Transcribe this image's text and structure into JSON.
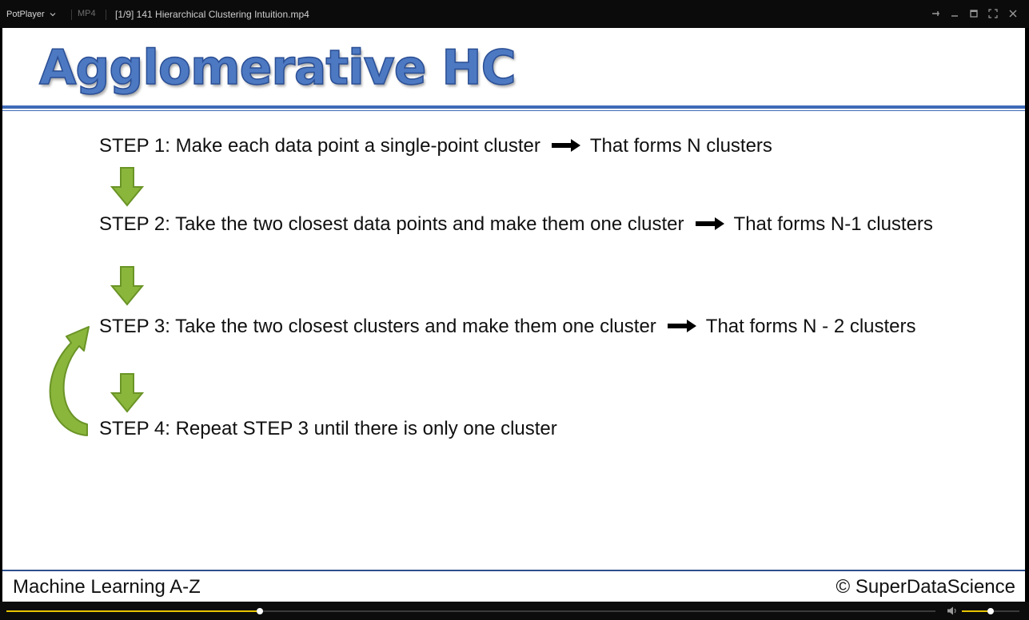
{
  "titlebar": {
    "app_name": "PotPlayer",
    "format_badge": "MP4",
    "file_title": "[1/9] 141 Hierarchical Clustering Intuition.mp4",
    "icons": [
      "chevron-down-icon",
      "pin-icon",
      "minimize-icon",
      "maximize-icon",
      "fullscreen-icon",
      "close-icon"
    ]
  },
  "slide": {
    "title": "Agglomerative HC",
    "steps": [
      {
        "label": "STEP 1",
        "text": ": Make each data point a single-point cluster",
        "result": "That forms N clusters"
      },
      {
        "label": "STEP 2",
        "text": ": Take the two closest data points and make them one cluster",
        "result": "That forms N-1 clusters"
      },
      {
        "label": "STEP 3",
        "text": ": Take the two closest clusters and make them one cluster",
        "result": "That forms N - 2 clusters"
      },
      {
        "label": "STEP 4",
        "text_pre": ": Repeat ",
        "ref": "STEP 3",
        "text_post": " until there is only one cluster"
      }
    ],
    "footer_left": "Machine Learning A-Z",
    "footer_right": "© SuperDataScience",
    "colors": {
      "title": "#4d79c2",
      "rule": "#3f6ab8",
      "arrow_green": "#8ab63c"
    }
  },
  "controls": {
    "seek_progress": 0.273,
    "volume_level": 0.5,
    "colors": {
      "progress": "#e7c400"
    }
  }
}
